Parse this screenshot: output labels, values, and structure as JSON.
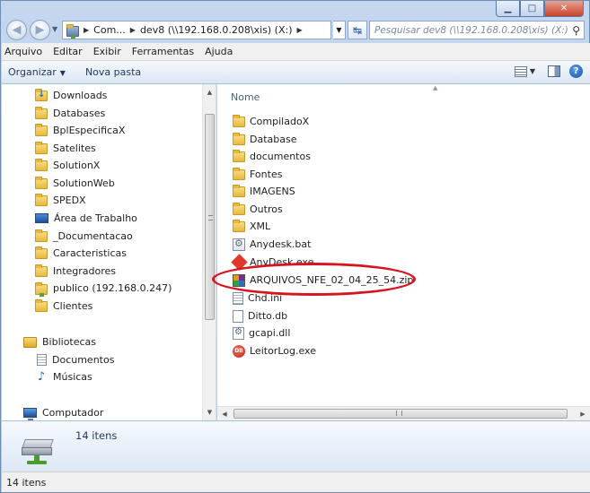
{
  "address": {
    "segments": [
      "Com...",
      "dev8 (\\\\192.168.0.208\\xis) (X:)"
    ],
    "search_placeholder": "Pesquisar dev8 (\\\\192.168.0.208\\xis) (X:)"
  },
  "menu": [
    "Arquivo",
    "Editar",
    "Exibir",
    "Ferramentas",
    "Ajuda"
  ],
  "toolbar": {
    "organize": "Organizar",
    "new_folder": "Nova pasta"
  },
  "nav": {
    "items": [
      {
        "label": "Downloads",
        "icon": "downloads-folder-icon"
      },
      {
        "label": "Databases",
        "icon": "folder-icon"
      },
      {
        "label": "BplEspecificaX",
        "icon": "folder-icon"
      },
      {
        "label": "Satelites",
        "icon": "folder-icon"
      },
      {
        "label": "SolutionX",
        "icon": "folder-icon"
      },
      {
        "label": "SolutionWeb",
        "icon": "folder-icon"
      },
      {
        "label": "SPEDX",
        "icon": "folder-icon"
      },
      {
        "label": "Área de Trabalho",
        "icon": "desktop-icon"
      },
      {
        "label": "_Documentacao",
        "icon": "folder-icon"
      },
      {
        "label": "Caracteristicas",
        "icon": "folder-icon"
      },
      {
        "label": "Integradores",
        "icon": "folder-icon"
      },
      {
        "label": "publico (192.168.0.247)",
        "icon": "network-folder-icon"
      },
      {
        "label": "Clientes",
        "icon": "folder-icon"
      }
    ],
    "libraries": {
      "label": "Bibliotecas",
      "children": [
        {
          "label": "Documentos",
          "icon": "documents-icon"
        },
        {
          "label": "Músicas",
          "icon": "music-icon"
        }
      ]
    },
    "computer": "Computador"
  },
  "content": {
    "column_header": "Nome",
    "files": [
      {
        "name": "CompiladoX",
        "type": "folder"
      },
      {
        "name": "Database",
        "type": "folder"
      },
      {
        "name": "documentos",
        "type": "folder"
      },
      {
        "name": "Fontes",
        "type": "folder"
      },
      {
        "name": "IMAGENS",
        "type": "folder"
      },
      {
        "name": "Outros",
        "type": "folder"
      },
      {
        "name": "XML",
        "type": "folder"
      },
      {
        "name": "Anydesk.bat",
        "type": "bat"
      },
      {
        "name": "AnyDesk.exe",
        "type": "anydesk"
      },
      {
        "name": "ARQUIVOS_NFE_02_04_25_54.zip",
        "type": "zip"
      },
      {
        "name": "Chd.ini",
        "type": "ini"
      },
      {
        "name": "Ditto.db",
        "type": "db"
      },
      {
        "name": "gcapi.dll",
        "type": "dll"
      },
      {
        "name": "LeitorLog.exe",
        "type": "exe"
      }
    ],
    "highlight_color": "#d8141e"
  },
  "details": {
    "count": "14 itens"
  },
  "status": {
    "count": "14 itens"
  }
}
